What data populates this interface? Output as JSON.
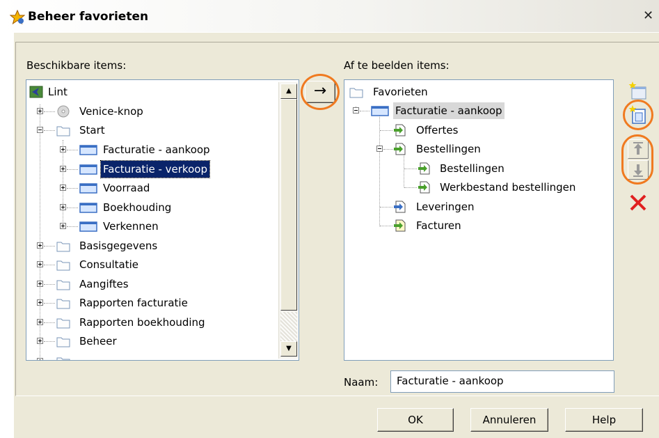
{
  "window": {
    "title": "Beheer favorieten",
    "close_glyph": "✕"
  },
  "available": {
    "label": "Beschikbare items:",
    "tree": [
      {
        "label": "Lint",
        "icon": "ribbon-icon"
      },
      {
        "label": "Venice-knop",
        "icon": "disc-icon"
      },
      {
        "label": "Start",
        "icon": "folder-icon"
      },
      {
        "label": "Facturatie - aankoop",
        "icon": "window-icon"
      },
      {
        "label": "Facturatie - verkoop",
        "icon": "window-icon",
        "selected": true
      },
      {
        "label": "Voorraad",
        "icon": "window-icon"
      },
      {
        "label": "Boekhouding",
        "icon": "window-icon"
      },
      {
        "label": "Verkennen",
        "icon": "window-icon"
      },
      {
        "label": "Basisgegevens",
        "icon": "folder-icon"
      },
      {
        "label": "Consultatie",
        "icon": "folder-icon"
      },
      {
        "label": "Aangiftes",
        "icon": "folder-icon"
      },
      {
        "label": "Rapporten facturatie",
        "icon": "folder-icon"
      },
      {
        "label": "Rapporten boekhouding",
        "icon": "folder-icon"
      },
      {
        "label": "Beheer",
        "icon": "folder-icon"
      }
    ]
  },
  "transfer": {
    "arrow": "→",
    "icon": "arrow-right-icon"
  },
  "display": {
    "label": "Af te beelden items:",
    "tree": [
      {
        "label": "Favorieten",
        "icon": "folder-icon"
      },
      {
        "label": "Facturatie - aankoop",
        "icon": "window-icon",
        "highlighted": true
      },
      {
        "label": "Offertes",
        "icon": "document-icon"
      },
      {
        "label": "Bestellingen",
        "icon": "document-icon"
      },
      {
        "label": "Bestellingen",
        "icon": "document-icon"
      },
      {
        "label": "Werkbestand bestellingen",
        "icon": "document-icon"
      },
      {
        "label": "Leveringen",
        "icon": "document-icon"
      },
      {
        "label": "Facturen",
        "icon": "document-icon"
      }
    ]
  },
  "toolbar": {
    "new_folder": "new-folder-icon",
    "new_item": "new-item-icon",
    "move_up": "move-up-icon",
    "move_down": "move-down-icon",
    "delete": "delete-icon"
  },
  "name_field": {
    "label": "Naam:",
    "value": "Facturatie - aankoop"
  },
  "buttons": {
    "ok": "OK",
    "cancel": "Annuleren",
    "help": "Help"
  },
  "colors": {
    "highlight_ring": "#f07a20",
    "selection": "#0a246a"
  }
}
